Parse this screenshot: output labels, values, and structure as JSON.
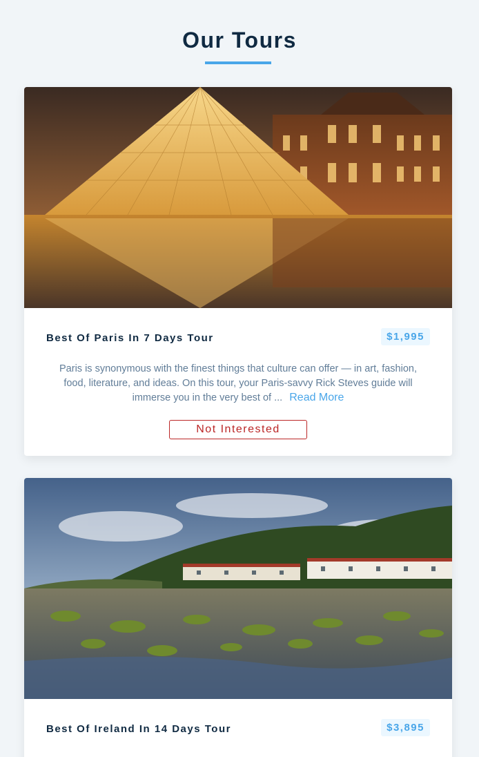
{
  "page": {
    "title": "Our Tours"
  },
  "colors": {
    "accent": "#49a6e9",
    "danger": "#bb2525",
    "heading": "#102a42",
    "body_text": "#617d98"
  },
  "tours": [
    {
      "image_subject": "Louvre pyramid at dusk",
      "name": "Best Of Paris In 7 Days Tour",
      "price": "$1,995",
      "description": "Paris is synonymous with the finest things that culture can offer — in art, fashion, food, literature, and ideas. On this tour, your Paris-savvy Rick Steves guide will immerse you in the very best of ...",
      "read_more_label": "Read More",
      "not_interested_label": "Not Interested"
    },
    {
      "image_subject": "Irish coastal village with mossy rocks",
      "name": "Best Of Ireland In 14 Days Tour",
      "price": "$3,895"
    }
  ]
}
